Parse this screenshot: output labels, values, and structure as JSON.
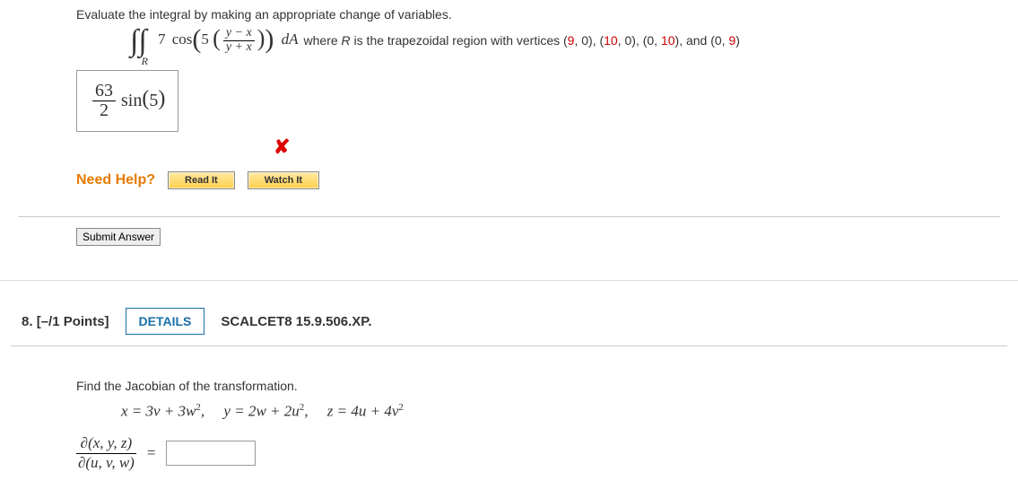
{
  "q7": {
    "prompt": "Evaluate the integral by making an appropriate change of variables.",
    "integral_subscript": "R",
    "coeff": "7",
    "cos_label": "cos",
    "inner_coeff": "5",
    "frac_num": "y − x",
    "frac_den": "y + x",
    "dA": "dA",
    "where_prefix": " where ",
    "region_var": "R",
    "where_mid": " is the trapezoidal region with vertices (",
    "v1a": "9",
    "v1b": ", 0), (",
    "v2a": "10",
    "v2b": ", 0), (0, ",
    "v3a": "10",
    "v3b": "), and (0, ",
    "v4a": "9",
    "v4b": ")",
    "answer_frac_num": "63",
    "answer_frac_den": "2",
    "answer_sin": "sin",
    "answer_arg": "5",
    "feedback_icon": "✘",
    "need_help_label": "Need Help?",
    "read_it": "Read It",
    "watch_it": "Watch It",
    "submit": "Submit Answer"
  },
  "q8": {
    "number": "8.",
    "points": "[–/1 Points]",
    "details": "DETAILS",
    "ref": "SCALCET8 15.9.506.XP.",
    "prompt": "Find the Jacobian of the transformation.",
    "eqn": "x = 3v + 3w²,    y = 2w + 2u²,    z = 4u + 4v²",
    "jac_num": "∂(x, y, z)",
    "jac_den": "∂(u, v, w)",
    "eq": "="
  }
}
